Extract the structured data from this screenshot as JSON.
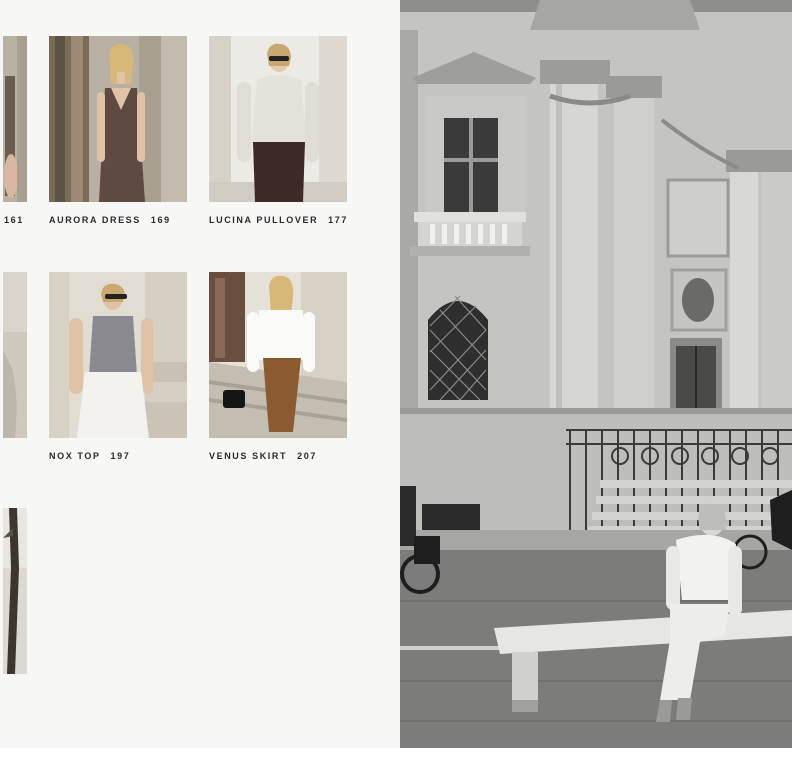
{
  "catalog": {
    "partial_number": "161",
    "items": [
      {
        "name": "AURORA DRESS",
        "page": "169"
      },
      {
        "name": "LUCINA PULLOVER",
        "page": "177"
      },
      {
        "name": "NOX TOP",
        "page": "197"
      },
      {
        "name": "VENUS SKIRT",
        "page": "207"
      }
    ]
  },
  "colors": {
    "page_bg": "#f7f7f6",
    "caption_text": "#2a2a2a",
    "aurora_dress": "#5e4a40",
    "lucina_skirt": "#3e2a24",
    "venus_skirt": "#8a5a30"
  }
}
